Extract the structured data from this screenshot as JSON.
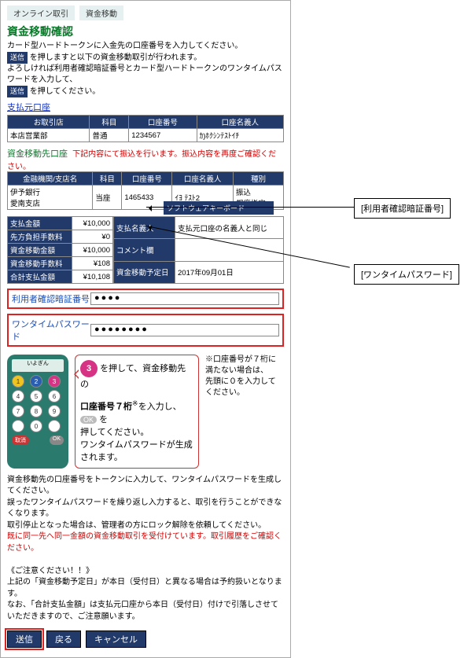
{
  "tabs": {
    "t1": "オンライン取引",
    "t2": "資金移動"
  },
  "title": "資金移動確認",
  "intro": {
    "line1": "カード型ハードトークンに入金先の口座番号を入力してください。",
    "badge": "送信",
    "line2": "を押しますと以下の資金移動取引が行われます。",
    "line3": "よろしければ利用者確認暗証番号とカード型ハードトークンのワンタイムパスワードを入力して、",
    "line4": "を押してください。"
  },
  "link_src": "支払元口座",
  "src_table": {
    "headers": [
      "お取引店",
      "科目",
      "口座番号",
      "口座名義人"
    ],
    "row": [
      "本店営業部",
      "普通",
      "1234567",
      "ｶ)ﾎｸｼﾝﾃｽﾄｲﾁ"
    ]
  },
  "dst_head": {
    "label": "資金移動先口座",
    "warn": "下記内容にて振込を行います。振込内容を再度ご確認ください。"
  },
  "dst_table": {
    "headers": [
      "金融機関/支店名",
      "科目",
      "口座番号",
      "口座名義人",
      "種別"
    ],
    "row": [
      "伊予銀行\n愛南支店",
      "当座",
      "1465433",
      "ｲﾖ ﾃｽﾄ2",
      "振込\n都度指定"
    ]
  },
  "amounts": {
    "rows": [
      {
        "h": "支払金額",
        "v": "¥10,000"
      },
      {
        "h": "先方負担手数料",
        "v": "¥0"
      },
      {
        "h": "資金移動金額",
        "v": "¥10,000"
      },
      {
        "h": "資金移動手数料",
        "v": "¥108"
      },
      {
        "h": "合計支払金額",
        "v": "¥10,108"
      }
    ],
    "right": [
      {
        "h": "支払名義人",
        "v": "支払元口座の名義人と同じ"
      },
      {
        "h": "コメント欄",
        "v": ""
      },
      {
        "h": "資金移動予定日",
        "v": "2017年09月01日"
      }
    ]
  },
  "form": {
    "label1": "利用者確認暗証番号",
    "label2": "ワンタイムパスワード",
    "dots1": "●●●●",
    "dots2": "●●●●●●●●",
    "banner": "ソフトウェアキーボード"
  },
  "bubble": {
    "num": "3",
    "t1": "を押して、資金移動先の",
    "t2a": "口座番号７桁",
    "t2b": "を入力し、",
    "ok": "OK",
    "t2c": "を",
    "t3": "押してください。",
    "t4": "ワンタイムパスワードが生成されます。"
  },
  "side_note": {
    "l1": "※口座番号が７桁に",
    "l2": "満たない場合は、",
    "l3": "先頭に０を入力して",
    "l4": "ください。"
  },
  "footer": {
    "p1": "資金移動先の口座番号をトークンに入力して、ワンタイムパスワードを生成してください。",
    "p2": "誤ったワンタイムパスワードを繰り返し入力すると、取引を行うことができなくなります。",
    "p3": "取引停止となった場合は、管理者の方にロック解除を依頼してください。",
    "p4": "既に同一先へ同一金額の資金移動取引を受付けています。取引履歴をご確認ください。",
    "h": "《ご注意ください！！》",
    "p5": "上記の「資金移動予定日」が本日（受付日）と異なる場合は予約扱いとなります。",
    "p6": "なお、「合計支払金額」は支払元口座から本日（受付日）付けで引落しさせていただきますので、ご注意願います。"
  },
  "buttons": {
    "send": "送信",
    "back": "戻る",
    "cancel": "キャンセル"
  },
  "callouts": {
    "c1": "[利用者確認暗証番号]",
    "c2": "[ワンタイムパスワード]"
  }
}
